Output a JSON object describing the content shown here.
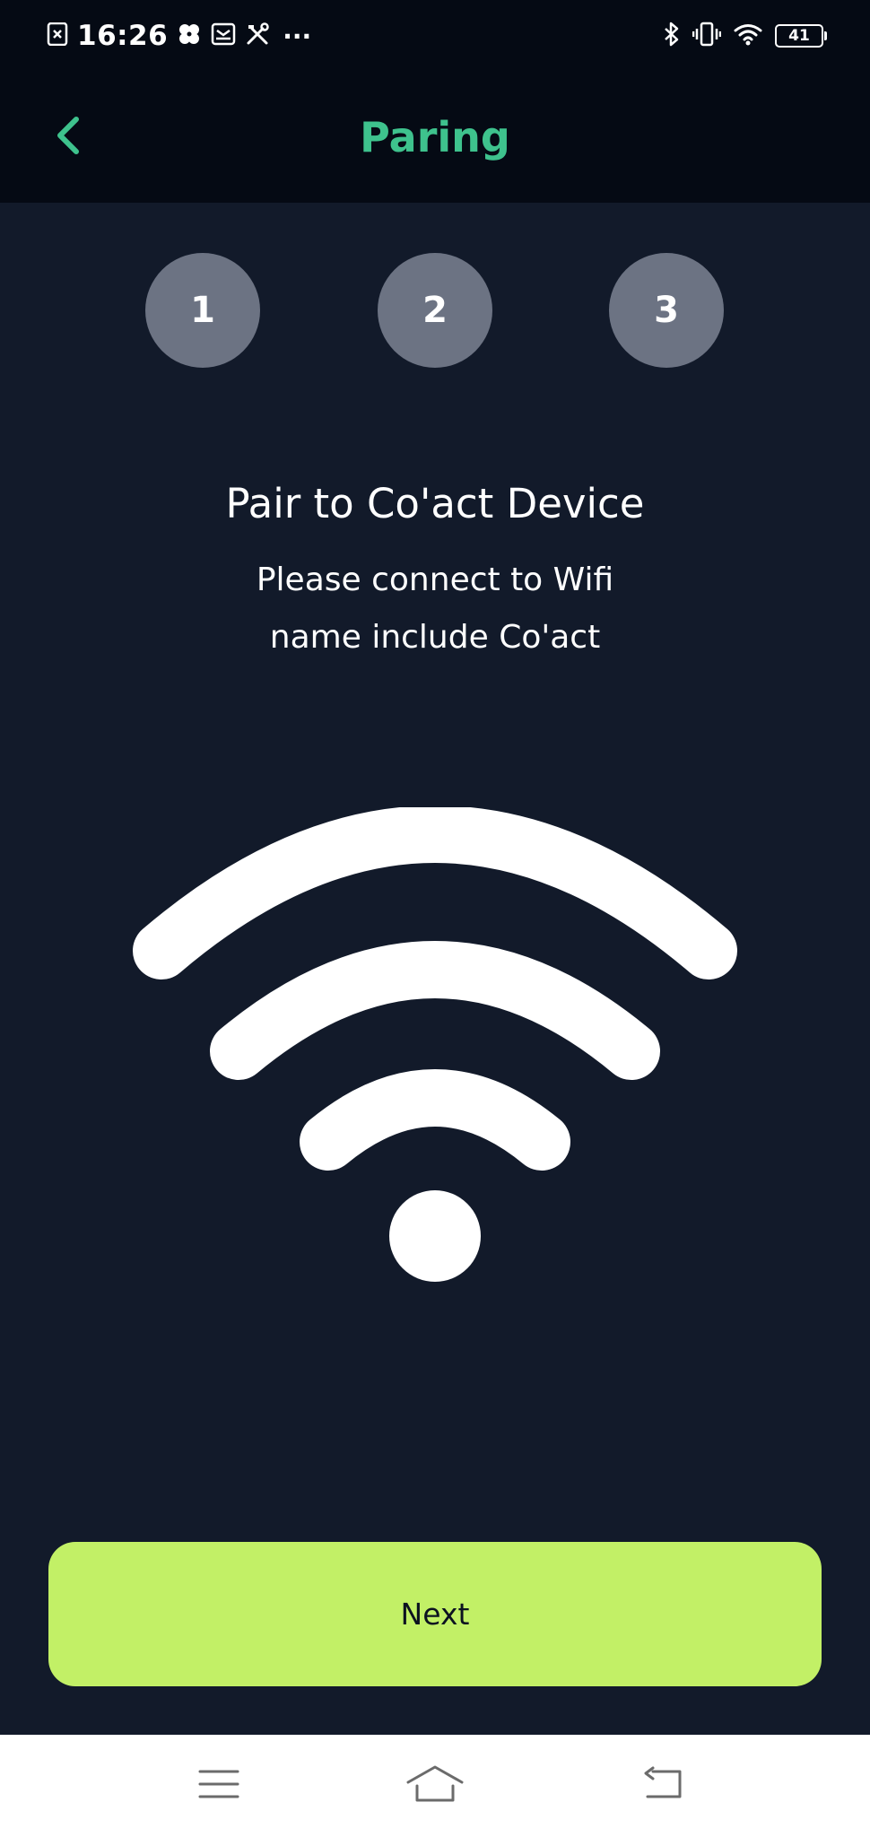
{
  "status_bar": {
    "time": "16:26",
    "more_indicator": "···",
    "battery_level": "41",
    "left_icons": [
      "sim-card-icon",
      "fan-icon",
      "mailbox-icon",
      "tools-icon"
    ],
    "right_icons": [
      "bluetooth-icon",
      "vibrate-icon",
      "wifi-status-icon",
      "battery-icon"
    ]
  },
  "header": {
    "title": "Paring",
    "back_icon": "chevron-left-icon",
    "accent_color": "#3ec28d"
  },
  "steps": [
    {
      "label": "1"
    },
    {
      "label": "2"
    },
    {
      "label": "3"
    }
  ],
  "content": {
    "heading": "Pair to Co'act Device",
    "instruction_line1": "Please connect to Wifi",
    "instruction_line2": "name include Co'act",
    "illustration_icon": "wifi-icon"
  },
  "actions": {
    "next_label": "Next",
    "next_color": "#c2f066"
  },
  "nav_bar": {
    "icons": [
      "menu-icon",
      "home-icon",
      "back-icon"
    ]
  },
  "colors": {
    "background": "#121a2a",
    "header_background": "#050a14",
    "step_circle": "#6c7383"
  }
}
